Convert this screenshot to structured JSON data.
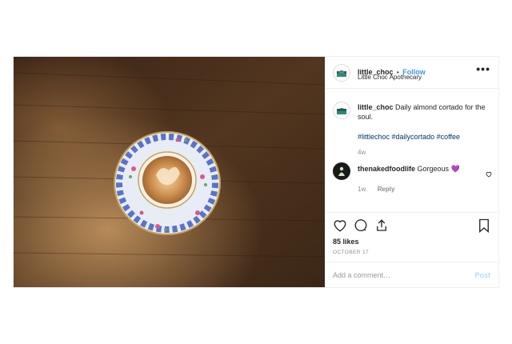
{
  "post": {
    "author": {
      "username": "little_choc",
      "follow_label": "Follow",
      "separator": "•",
      "location": "Little Choc Apothecary",
      "avatar_icon": "little-choc-logo-icon"
    },
    "more_icon": "more-options-icon",
    "more_glyph": "•••",
    "caption": {
      "username": "little_choc",
      "text": "Daily almond cortado for the soul.",
      "hashtags": [
        "#littlechoc",
        "#dailycortado",
        "#coffee"
      ],
      "age": "4w"
    },
    "comments": [
      {
        "username": "thenakedfoodlife",
        "text": "Gorgeous",
        "emoji": "💜",
        "age": "1w",
        "reply_label": "Reply"
      }
    ],
    "actions": {
      "like_icon": "heart-icon",
      "comment_icon": "comment-icon",
      "share_icon": "share-icon",
      "save_icon": "bookmark-icon"
    },
    "likes": "85 likes",
    "date": "OCTOBER 17",
    "add_comment_placeholder": "Add a comment…",
    "post_label": "Post"
  },
  "colors": {
    "link_blue": "#3897f0",
    "post_disabled": "#b2dffc",
    "hashtag": "#003569",
    "muted": "#8e8e8e",
    "wood": "#4a3220"
  }
}
